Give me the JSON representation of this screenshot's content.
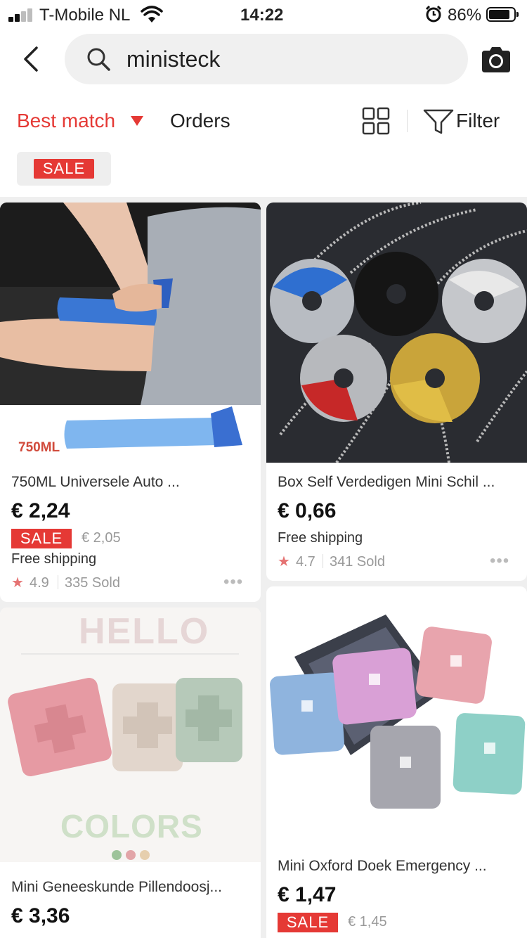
{
  "status_bar": {
    "carrier": "T-Mobile NL",
    "time": "14:22",
    "battery_percent": "86%",
    "battery_level": 0.86
  },
  "search": {
    "query": "ministeck"
  },
  "sort": {
    "best_match": "Best match",
    "orders": "Orders",
    "filter": "Filter"
  },
  "chips": {
    "sale": "SALE"
  },
  "products": [
    {
      "title": "750ML Universele Auto ...",
      "price": "€ 2,24",
      "sale": "SALE",
      "old_price": "€ 2,05",
      "shipping": "Free shipping",
      "rating": "4.9",
      "sold": "335 Sold",
      "image_label": "750ML"
    },
    {
      "title": "Box Self Verdedigen Mini Schil ...",
      "price": "€ 0,66",
      "shipping": "Free shipping",
      "rating": "4.7",
      "sold": "341 Sold"
    },
    {
      "title": "Mini Geneeskunde Pillendoosj...",
      "price": "€ 3,36",
      "image_text_top": "HELLO",
      "image_text_bottom": "COLORS"
    },
    {
      "title": "Mini Oxford Doek Emergency ...",
      "price": "€ 1,47",
      "sale": "SALE",
      "old_price": "€ 1,45"
    }
  ],
  "icons": {
    "back": "chevron-left-icon",
    "search": "search-icon",
    "camera": "camera-icon",
    "grid": "grid-view-icon",
    "filter": "filter-icon",
    "star": "star-icon",
    "more": "more-dots-icon"
  },
  "colors": {
    "accent": "#e53935",
    "background": "#efefef"
  }
}
